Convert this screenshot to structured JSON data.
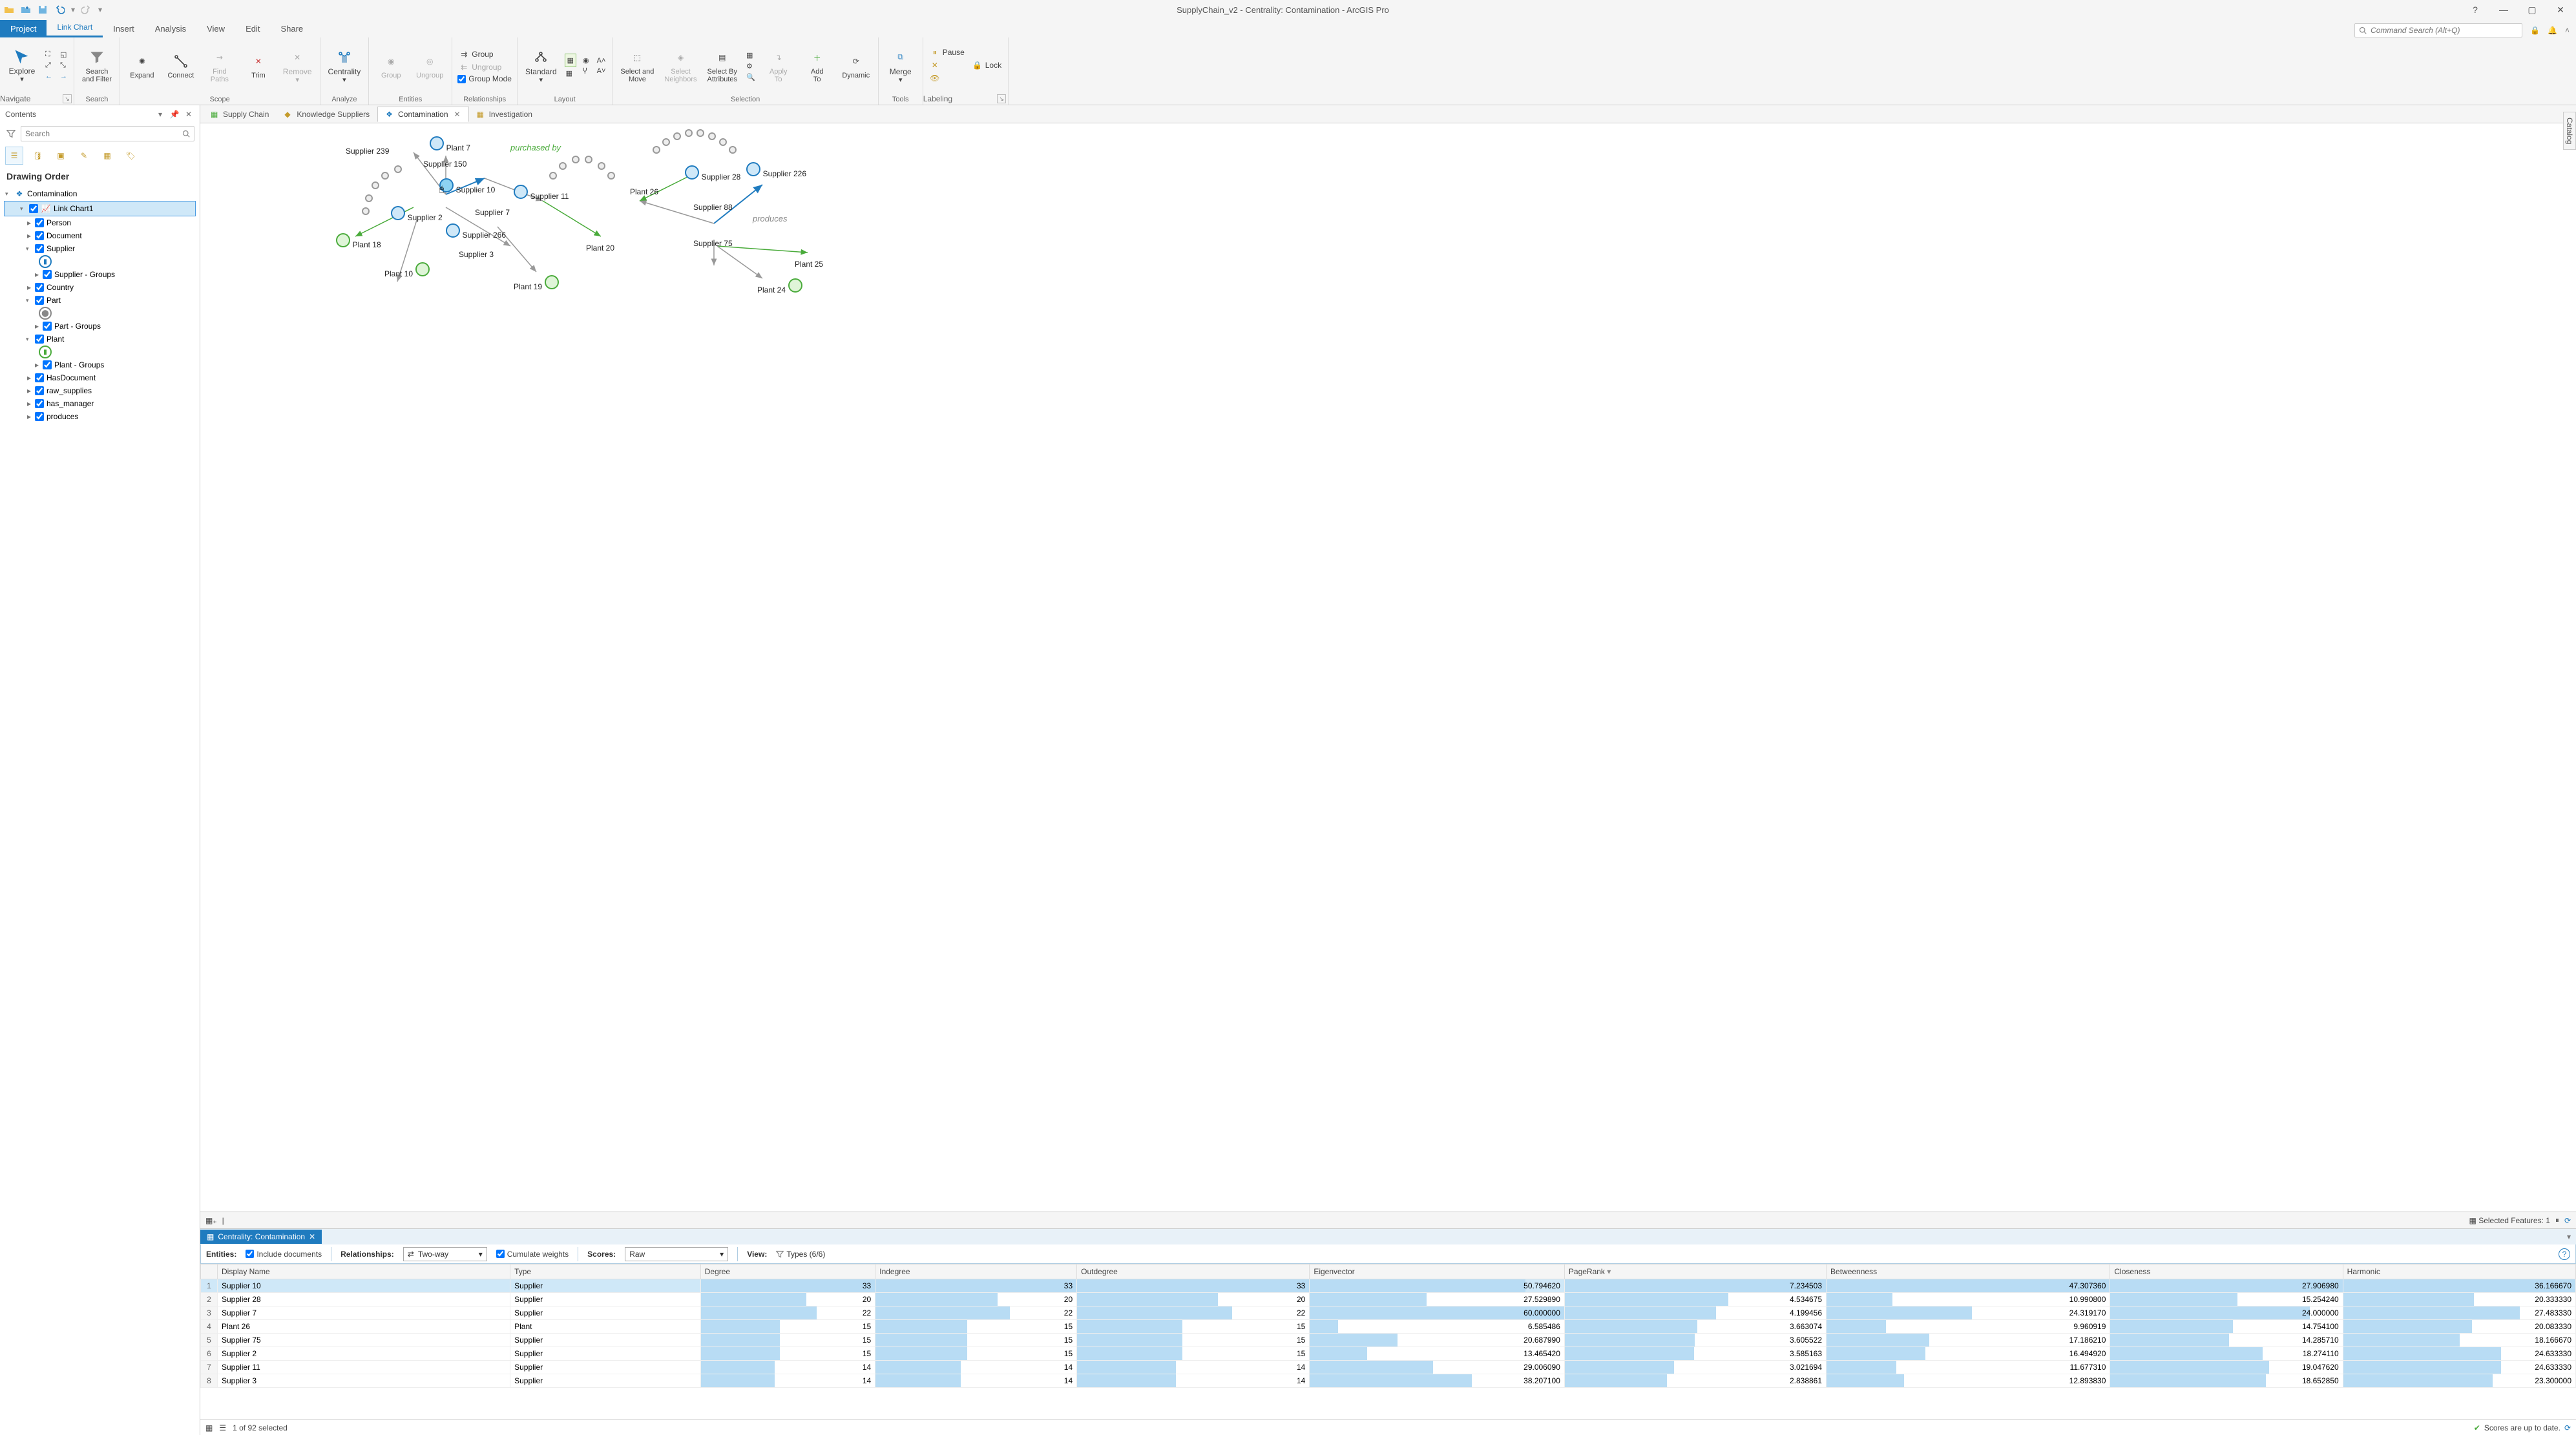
{
  "window": {
    "title": "SupplyChain_v2 - Centrality: Contamination - ArcGIS Pro"
  },
  "ribbon": {
    "tabs": {
      "project": "Project",
      "linkchart": "Link Chart",
      "insert": "Insert",
      "analysis": "Analysis",
      "view": "View",
      "edit": "Edit",
      "share": "Share"
    },
    "search_placeholder": "Command Search (Alt+Q)",
    "groups": {
      "navigate": {
        "label": "Navigate",
        "explore": "Explore"
      },
      "search": {
        "label": "Search",
        "search_filter": "Search\nand Filter"
      },
      "scope": {
        "label": "Scope",
        "expand": "Expand",
        "connect": "Connect",
        "find_paths": "Find\nPaths",
        "trim": "Trim",
        "remove": "Remove"
      },
      "analyze": {
        "label": "Analyze",
        "centrality": "Centrality"
      },
      "entities": {
        "label": "Entities",
        "group": "Group",
        "ungroup": "Ungroup"
      },
      "relationships": {
        "label": "Relationships",
        "group": "Group",
        "ungroup": "Ungroup",
        "group_mode": "Group Mode"
      },
      "layout": {
        "label": "Layout",
        "standard": "Standard"
      },
      "selection": {
        "label": "Selection",
        "select_move": "Select and\nMove",
        "select_neighbors": "Select\nNeighbors",
        "select_attr": "Select By\nAttributes",
        "apply_to": "Apply\nTo",
        "add_to": "Add\nTo",
        "dynamic": "Dynamic"
      },
      "tools": {
        "label": "Tools",
        "merge": "Merge"
      },
      "labeling": {
        "label": "Labeling",
        "pause": "Pause",
        "lock": "Lock"
      }
    }
  },
  "contents": {
    "title": "Contents",
    "search_placeholder": "Search",
    "section": "Drawing Order",
    "root": "Contamination",
    "link_chart": "Link Chart1",
    "layers": {
      "person": "Person",
      "document": "Document",
      "supplier": "Supplier",
      "supplier_groups": "Supplier - Groups",
      "country": "Country",
      "part": "Part",
      "part_groups": "Part - Groups",
      "plant": "Plant",
      "plant_groups": "Plant - Groups",
      "has_document": "HasDocument",
      "raw_supplies": "raw_supplies",
      "has_manager": "has_manager",
      "produces": "produces"
    }
  },
  "doc_tabs": {
    "supply_chain": "Supply Chain",
    "knowledge_suppliers": "Knowledge Suppliers",
    "contamination": "Contamination",
    "investigation": "Investigation"
  },
  "graph": {
    "labels": {
      "supplier239": "Supplier 239",
      "plant7": "Plant 7",
      "supplier150": "Supplier 150",
      "supplier10": "Supplier 10",
      "supplier11": "Supplier 11",
      "supplier2": "Supplier 2",
      "supplier7": "Supplier 7",
      "supplier266": "Supplier 266",
      "supplier3": "Supplier 3",
      "plant18": "Plant 18",
      "plant10": "Plant 10",
      "plant19": "Plant 19",
      "plant20": "Plant 20",
      "plant26": "Plant 26",
      "supplier28": "Supplier 28",
      "supplier226": "Supplier 226",
      "supplier88": "Supplier 88",
      "supplier75": "Supplier 75",
      "plant25": "Plant 25",
      "plant24": "Plant 24",
      "purchased_by": "purchased by",
      "produces": "produces"
    },
    "selected_features": "Selected Features: 1"
  },
  "centrality": {
    "tab_title": "Centrality: Contamination",
    "toolbar": {
      "entities_label": "Entities:",
      "include_docs": "Include documents",
      "relationships_label": "Relationships:",
      "direction": "Two-way",
      "cumulate": "Cumulate weights",
      "scores_label": "Scores:",
      "scores_value": "Raw",
      "view_label": "View:",
      "types": "Types (6/6)"
    },
    "columns": {
      "display_name": "Display Name",
      "type": "Type",
      "degree": "Degree",
      "indegree": "Indegree",
      "outdegree": "Outdegree",
      "eigenvector": "Eigenvector",
      "pagerank": "PageRank",
      "betweenness": "Betweenness",
      "closeness": "Closeness",
      "harmonic": "Harmonic"
    },
    "rows": [
      {
        "n": 1,
        "name": "Supplier 10",
        "type": "Supplier",
        "deg": 33,
        "in": 33,
        "out": 33,
        "eig": "50.794620",
        "pr": "7.234503",
        "bet": "47.307360",
        "clo": "27.906980",
        "har": "36.166670"
      },
      {
        "n": 2,
        "name": "Supplier 28",
        "type": "Supplier",
        "deg": 20,
        "in": 20,
        "out": 20,
        "eig": "27.529890",
        "pr": "4.534675",
        "bet": "10.990800",
        "clo": "15.254240",
        "har": "20.333330"
      },
      {
        "n": 3,
        "name": "Supplier 7",
        "type": "Supplier",
        "deg": 22,
        "in": 22,
        "out": 22,
        "eig": "60.000000",
        "pr": "4.199456",
        "bet": "24.319170",
        "clo": "24.000000",
        "har": "27.483330"
      },
      {
        "n": 4,
        "name": "Plant 26",
        "type": "Plant",
        "deg": 15,
        "in": 15,
        "out": 15,
        "eig": "6.585486",
        "pr": "3.663074",
        "bet": "9.960919",
        "clo": "14.754100",
        "har": "20.083330"
      },
      {
        "n": 5,
        "name": "Supplier 75",
        "type": "Supplier",
        "deg": 15,
        "in": 15,
        "out": 15,
        "eig": "20.687990",
        "pr": "3.605522",
        "bet": "17.186210",
        "clo": "14.285710",
        "har": "18.166670"
      },
      {
        "n": 6,
        "name": "Supplier 2",
        "type": "Supplier",
        "deg": 15,
        "in": 15,
        "out": 15,
        "eig": "13.465420",
        "pr": "3.585163",
        "bet": "16.494920",
        "clo": "18.274110",
        "har": "24.633330"
      },
      {
        "n": 7,
        "name": "Supplier 11",
        "type": "Supplier",
        "deg": 14,
        "in": 14,
        "out": 14,
        "eig": "29.006090",
        "pr": "3.021694",
        "bet": "11.677310",
        "clo": "19.047620",
        "har": "24.633330"
      },
      {
        "n": 8,
        "name": "Supplier 3",
        "type": "Supplier",
        "deg": 14,
        "in": 14,
        "out": 14,
        "eig": "38.207100",
        "pr": "2.838861",
        "bet": "12.893830",
        "clo": "18.652850",
        "har": "23.300000"
      }
    ],
    "max": {
      "deg": 33,
      "in": 33,
      "out": 33,
      "eig": 60,
      "pr": 7.234503,
      "bet": 47.30736,
      "clo": 27.90698,
      "har": 36.16667
    },
    "footer": {
      "selected": "1 of 92 selected",
      "status": "Scores are up to date."
    }
  },
  "catalog_label": "Catalog"
}
